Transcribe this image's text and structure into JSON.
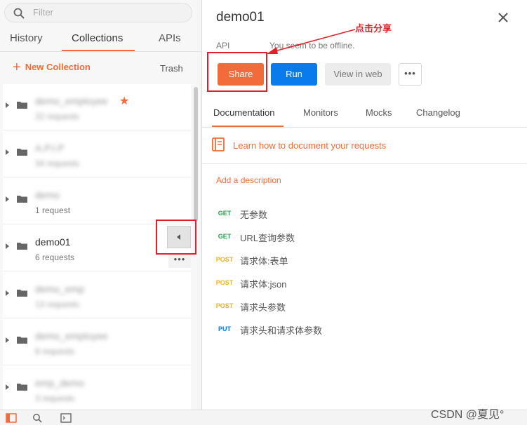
{
  "sidebar": {
    "search_placeholder": "Filter",
    "tabs": [
      {
        "label": "History"
      },
      {
        "label": "Collections"
      },
      {
        "label": "APIs"
      }
    ],
    "new_collection_label": "New Collection",
    "trash_label": "Trash",
    "collections": [
      {
        "name": "demo_employee",
        "count": "22 requests",
        "blurred": true,
        "starred": true
      },
      {
        "name": "A.P.I.P",
        "count": "34 requests",
        "blurred": true
      },
      {
        "name": "demo",
        "count": "1 request",
        "blurred_name": true
      },
      {
        "name": "demo01",
        "count": "6 requests",
        "blurred": false
      },
      {
        "name": "demo_emp",
        "count": "13 requests",
        "blurred": true
      },
      {
        "name": "demo_employee",
        "count": "8 requests",
        "blurred": true
      },
      {
        "name": "emp_demo",
        "count": "3 requests",
        "blurred": true
      }
    ],
    "more_dots": "•••"
  },
  "detail": {
    "title": "demo01",
    "api_label": "API",
    "offline_text": "You seem to be offline.",
    "annotation": "点击分享",
    "share_label": "Share",
    "run_label": "Run",
    "view_web_label": "View in web",
    "more_dots": "•••",
    "tabs": [
      {
        "label": "Documentation"
      },
      {
        "label": "Monitors"
      },
      {
        "label": "Mocks"
      },
      {
        "label": "Changelog"
      }
    ],
    "learn_link": "Learn how to document your requests",
    "add_description": "Add a description",
    "requests": [
      {
        "method": "GET",
        "name": "无参数"
      },
      {
        "method": "GET",
        "name": "URL查询参数"
      },
      {
        "method": "POST",
        "name": "请求体:表单"
      },
      {
        "method": "POST",
        "name": "请求体:json"
      },
      {
        "method": "POST",
        "name": "请求头参数"
      },
      {
        "method": "PUT",
        "name": "请求头和请求体参数"
      }
    ]
  },
  "watermark": "CSDN @夏见°",
  "colors": {
    "accent": "#f26b3a",
    "run_blue": "#097bed",
    "annotation_red": "#e0202a",
    "get_green": "#2a9d48",
    "post_yellow": "#f2b11a"
  }
}
